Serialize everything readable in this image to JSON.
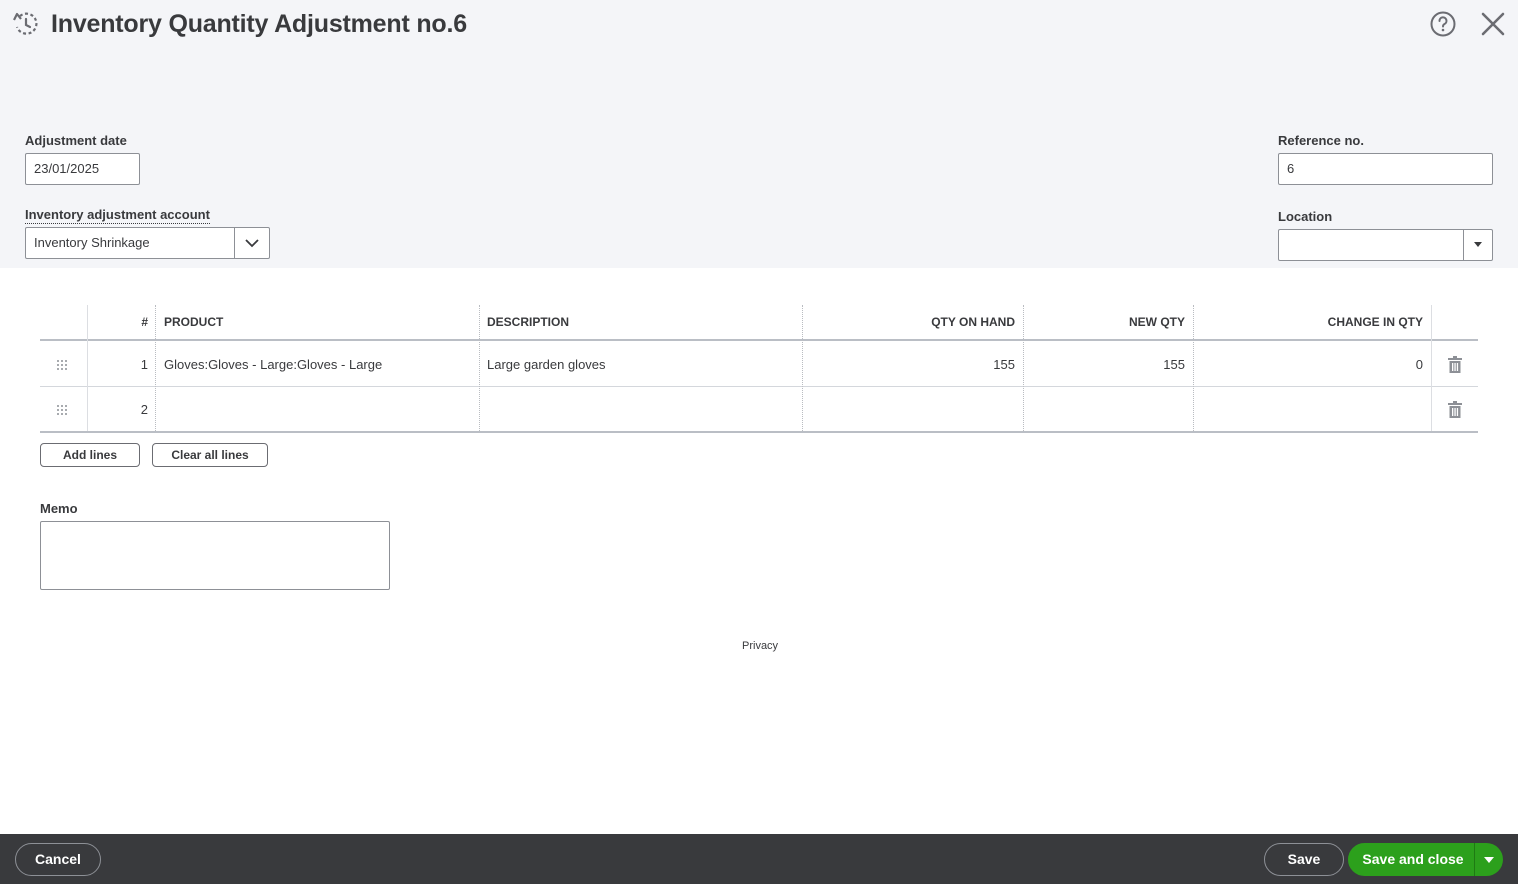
{
  "header": {
    "title": "Inventory Quantity Adjustment no.6"
  },
  "form": {
    "adjustment_date_label": "Adjustment date",
    "adjustment_date_value": "23/01/2025",
    "account_label": "Inventory adjustment account",
    "account_value": "Inventory Shrinkage",
    "reference_label": "Reference no.",
    "reference_value": "6",
    "location_label": "Location",
    "location_value": ""
  },
  "table": {
    "columns": [
      "#",
      "PRODUCT",
      "DESCRIPTION",
      "QTY ON HAND",
      "NEW QTY",
      "CHANGE IN QTY"
    ],
    "rows": [
      {
        "num": "1",
        "product": "Gloves:Gloves - Large:Gloves - Large",
        "description": "Large garden gloves",
        "qty_on_hand": "155",
        "new_qty": "155",
        "change_in_qty": "0"
      },
      {
        "num": "2",
        "product": "",
        "description": "",
        "qty_on_hand": "",
        "new_qty": "",
        "change_in_qty": ""
      }
    ],
    "add_lines_label": "Add lines",
    "clear_lines_label": "Clear all lines"
  },
  "memo": {
    "label": "Memo",
    "value": ""
  },
  "privacy_label": "Privacy",
  "footer": {
    "cancel_label": "Cancel",
    "save_label": "Save",
    "save_close_label": "Save and close"
  },
  "colors": {
    "header_bg": "#f4f5f8",
    "footer_bg": "#393a3d",
    "primary_green": "#2ca01c",
    "text": "#393a3d"
  },
  "icons": [
    "history-icon",
    "help-icon",
    "close-icon",
    "chevron-down-icon",
    "caret-down-icon",
    "drag-grip-icon",
    "trash-icon"
  ]
}
